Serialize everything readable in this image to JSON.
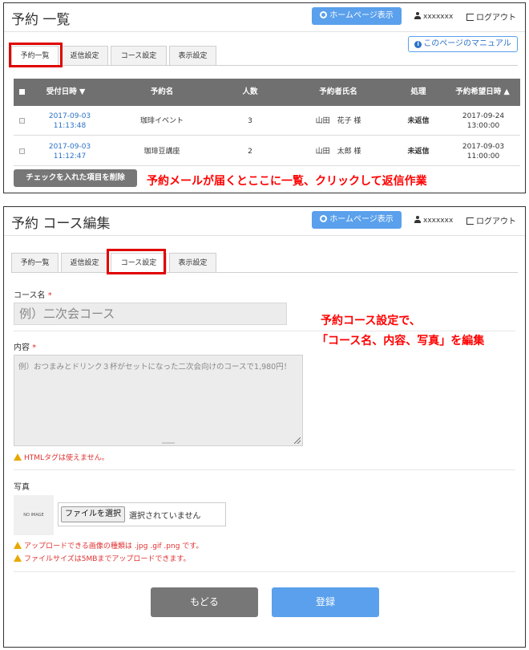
{
  "header": {
    "home_button_label": "ホームページ表示",
    "username": "xxxxxxx",
    "logout_label": "ログアウト"
  },
  "panel1": {
    "title": "予約 一覧",
    "tabs": [
      "予約一覧",
      "返信設定",
      "コース設定",
      "表示設定"
    ],
    "manual_label": "このページのマニュアル",
    "table": {
      "headers": [
        "受付日時 ▼",
        "予約名",
        "人数",
        "予約者氏名",
        "処理",
        "予約希望日時 ▲"
      ],
      "rows": [
        {
          "received_date": "2017-09-03",
          "received_time": "11:13:48",
          "name": "珈琲イベント",
          "count": "3",
          "customer": "山田　花子 様",
          "status": "未返信",
          "desired_date": "2017-09-24",
          "desired_time": "13:00:00"
        },
        {
          "received_date": "2017-09-03",
          "received_time": "11:12:47",
          "name": "珈琲豆講座",
          "count": "2",
          "customer": "山田　太郎 様",
          "status": "未返信",
          "desired_date": "2017-09-03",
          "desired_time": "11:00:00"
        }
      ]
    },
    "delete_button_label": "チェックを入れた項目を削除",
    "annotation": "予約メールが届くとここに一覧、クリックして返信作業"
  },
  "panel2": {
    "title": "予約 コース編集",
    "tabs": [
      "予約一覧",
      "返信設定",
      "コース設定",
      "表示設定"
    ],
    "course_name_label": "コース名",
    "required_mark": "*",
    "course_name_placeholder": "例）二次会コース",
    "content_label": "内容",
    "content_placeholder": "例）おつまみとドリンク３杯がセットになった二次会向けのコースで1,980円！",
    "html_warning": "HTMLタグは使えません。",
    "photo_label": "写真",
    "no_image_text": "NO IMAGE",
    "file_button_label": "ファイルを選択",
    "file_status": "選択されていません",
    "upload_warning_types": "アップロードできる画像の種類は .jpg .gif .png です。",
    "upload_warning_size": "ファイルサイズは5MBまでアップロードできます。",
    "back_button_label": "もどる",
    "submit_button_label": "登録",
    "annotation_line1": "予約コース設定で、",
    "annotation_line2": "「コース名、内容、写真」を編集"
  }
}
